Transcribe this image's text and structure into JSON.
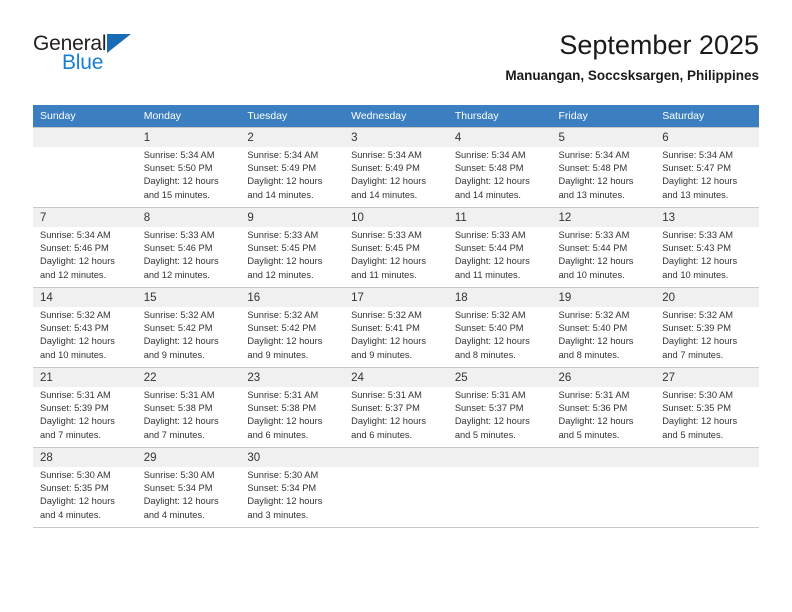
{
  "brand": {
    "name_top": "General",
    "name_bottom": "Blue",
    "accent_color": "#1a7fd4",
    "triangle_color": "#1a6bb5"
  },
  "header": {
    "title": "September 2025",
    "subtitle": "Manuangan, Soccsksargen, Philippines"
  },
  "calendar": {
    "header_bg": "#3c7fc1",
    "weekdays": [
      "Sunday",
      "Monday",
      "Tuesday",
      "Wednesday",
      "Thursday",
      "Friday",
      "Saturday"
    ],
    "weeks": [
      [
        {
          "day": "",
          "lines": []
        },
        {
          "day": "1",
          "lines": [
            "Sunrise: 5:34 AM",
            "Sunset: 5:50 PM",
            "Daylight: 12 hours",
            "and 15 minutes."
          ]
        },
        {
          "day": "2",
          "lines": [
            "Sunrise: 5:34 AM",
            "Sunset: 5:49 PM",
            "Daylight: 12 hours",
            "and 14 minutes."
          ]
        },
        {
          "day": "3",
          "lines": [
            "Sunrise: 5:34 AM",
            "Sunset: 5:49 PM",
            "Daylight: 12 hours",
            "and 14 minutes."
          ]
        },
        {
          "day": "4",
          "lines": [
            "Sunrise: 5:34 AM",
            "Sunset: 5:48 PM",
            "Daylight: 12 hours",
            "and 14 minutes."
          ]
        },
        {
          "day": "5",
          "lines": [
            "Sunrise: 5:34 AM",
            "Sunset: 5:48 PM",
            "Daylight: 12 hours",
            "and 13 minutes."
          ]
        },
        {
          "day": "6",
          "lines": [
            "Sunrise: 5:34 AM",
            "Sunset: 5:47 PM",
            "Daylight: 12 hours",
            "and 13 minutes."
          ]
        }
      ],
      [
        {
          "day": "7",
          "lines": [
            "Sunrise: 5:34 AM",
            "Sunset: 5:46 PM",
            "Daylight: 12 hours",
            "and 12 minutes."
          ]
        },
        {
          "day": "8",
          "lines": [
            "Sunrise: 5:33 AM",
            "Sunset: 5:46 PM",
            "Daylight: 12 hours",
            "and 12 minutes."
          ]
        },
        {
          "day": "9",
          "lines": [
            "Sunrise: 5:33 AM",
            "Sunset: 5:45 PM",
            "Daylight: 12 hours",
            "and 12 minutes."
          ]
        },
        {
          "day": "10",
          "lines": [
            "Sunrise: 5:33 AM",
            "Sunset: 5:45 PM",
            "Daylight: 12 hours",
            "and 11 minutes."
          ]
        },
        {
          "day": "11",
          "lines": [
            "Sunrise: 5:33 AM",
            "Sunset: 5:44 PM",
            "Daylight: 12 hours",
            "and 11 minutes."
          ]
        },
        {
          "day": "12",
          "lines": [
            "Sunrise: 5:33 AM",
            "Sunset: 5:44 PM",
            "Daylight: 12 hours",
            "and 10 minutes."
          ]
        },
        {
          "day": "13",
          "lines": [
            "Sunrise: 5:33 AM",
            "Sunset: 5:43 PM",
            "Daylight: 12 hours",
            "and 10 minutes."
          ]
        }
      ],
      [
        {
          "day": "14",
          "lines": [
            "Sunrise: 5:32 AM",
            "Sunset: 5:43 PM",
            "Daylight: 12 hours",
            "and 10 minutes."
          ]
        },
        {
          "day": "15",
          "lines": [
            "Sunrise: 5:32 AM",
            "Sunset: 5:42 PM",
            "Daylight: 12 hours",
            "and 9 minutes."
          ]
        },
        {
          "day": "16",
          "lines": [
            "Sunrise: 5:32 AM",
            "Sunset: 5:42 PM",
            "Daylight: 12 hours",
            "and 9 minutes."
          ]
        },
        {
          "day": "17",
          "lines": [
            "Sunrise: 5:32 AM",
            "Sunset: 5:41 PM",
            "Daylight: 12 hours",
            "and 9 minutes."
          ]
        },
        {
          "day": "18",
          "lines": [
            "Sunrise: 5:32 AM",
            "Sunset: 5:40 PM",
            "Daylight: 12 hours",
            "and 8 minutes."
          ]
        },
        {
          "day": "19",
          "lines": [
            "Sunrise: 5:32 AM",
            "Sunset: 5:40 PM",
            "Daylight: 12 hours",
            "and 8 minutes."
          ]
        },
        {
          "day": "20",
          "lines": [
            "Sunrise: 5:32 AM",
            "Sunset: 5:39 PM",
            "Daylight: 12 hours",
            "and 7 minutes."
          ]
        }
      ],
      [
        {
          "day": "21",
          "lines": [
            "Sunrise: 5:31 AM",
            "Sunset: 5:39 PM",
            "Daylight: 12 hours",
            "and 7 minutes."
          ]
        },
        {
          "day": "22",
          "lines": [
            "Sunrise: 5:31 AM",
            "Sunset: 5:38 PM",
            "Daylight: 12 hours",
            "and 7 minutes."
          ]
        },
        {
          "day": "23",
          "lines": [
            "Sunrise: 5:31 AM",
            "Sunset: 5:38 PM",
            "Daylight: 12 hours",
            "and 6 minutes."
          ]
        },
        {
          "day": "24",
          "lines": [
            "Sunrise: 5:31 AM",
            "Sunset: 5:37 PM",
            "Daylight: 12 hours",
            "and 6 minutes."
          ]
        },
        {
          "day": "25",
          "lines": [
            "Sunrise: 5:31 AM",
            "Sunset: 5:37 PM",
            "Daylight: 12 hours",
            "and 5 minutes."
          ]
        },
        {
          "day": "26",
          "lines": [
            "Sunrise: 5:31 AM",
            "Sunset: 5:36 PM",
            "Daylight: 12 hours",
            "and 5 minutes."
          ]
        },
        {
          "day": "27",
          "lines": [
            "Sunrise: 5:30 AM",
            "Sunset: 5:35 PM",
            "Daylight: 12 hours",
            "and 5 minutes."
          ]
        }
      ],
      [
        {
          "day": "28",
          "lines": [
            "Sunrise: 5:30 AM",
            "Sunset: 5:35 PM",
            "Daylight: 12 hours",
            "and 4 minutes."
          ]
        },
        {
          "day": "29",
          "lines": [
            "Sunrise: 5:30 AM",
            "Sunset: 5:34 PM",
            "Daylight: 12 hours",
            "and 4 minutes."
          ]
        },
        {
          "day": "30",
          "lines": [
            "Sunrise: 5:30 AM",
            "Sunset: 5:34 PM",
            "Daylight: 12 hours",
            "and 3 minutes."
          ]
        },
        {
          "day": "",
          "lines": []
        },
        {
          "day": "",
          "lines": []
        },
        {
          "day": "",
          "lines": []
        },
        {
          "day": "",
          "lines": []
        }
      ]
    ]
  }
}
